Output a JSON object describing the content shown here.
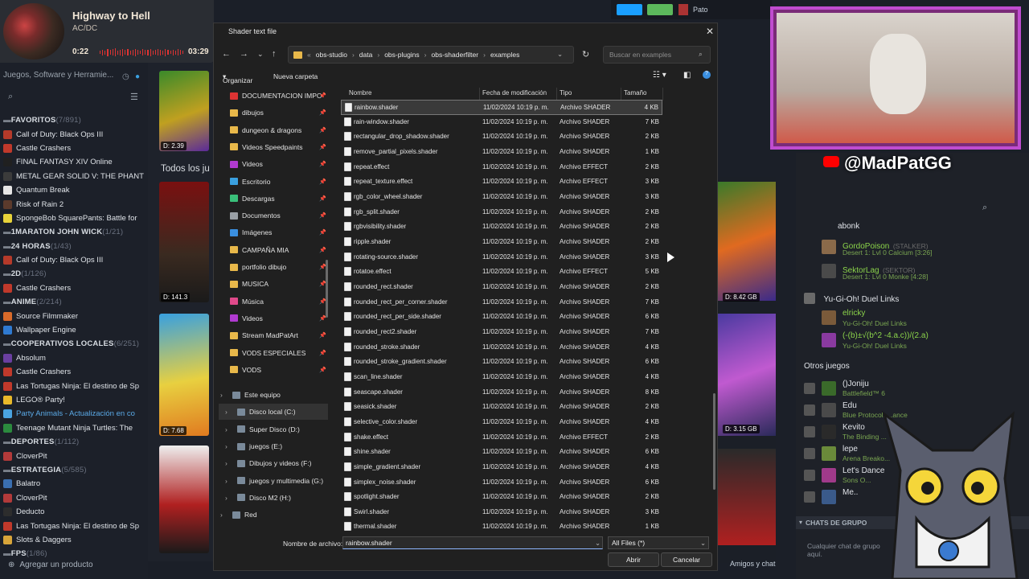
{
  "now_playing": {
    "title": "Highway to Hell",
    "artist": "AC/DC",
    "elapsed": "0:22",
    "total": "03:29",
    "progress": 0.11
  },
  "library": {
    "filter_label": "Juegos, Software y Herramie...",
    "groups": [
      {
        "type": "group",
        "name": "FAVORITOS",
        "count": "(7/891)"
      },
      {
        "type": "item",
        "name": "Call of Duty: Black Ops III",
        "color": "#b53a2a"
      },
      {
        "type": "item",
        "name": "Castle Crashers",
        "color": "#c0392b"
      },
      {
        "type": "item",
        "name": "FINAL FANTASY XIV Online",
        "color": "#202020"
      },
      {
        "type": "item",
        "name": "METAL GEAR SOLID V: THE PHANT",
        "color": "#3b3b3b"
      },
      {
        "type": "item",
        "name": "Quantum Break",
        "color": "#e6e6e6"
      },
      {
        "type": "item",
        "name": "Risk of Rain 2",
        "color": "#5b3a2c"
      },
      {
        "type": "item",
        "name": "SpongeBob SquarePants: Battle for",
        "color": "#e8d33a"
      },
      {
        "type": "group",
        "name": "1MARATON JOHN WICK",
        "count": "(1/21)"
      },
      {
        "type": "group",
        "name": "24 HORAS",
        "count": "(1/43)"
      },
      {
        "type": "item",
        "name": "Call of Duty: Black Ops III",
        "color": "#b53a2a"
      },
      {
        "type": "group",
        "name": "2D",
        "count": "(1/126)"
      },
      {
        "type": "item",
        "name": "Castle Crashers",
        "color": "#c0392b"
      },
      {
        "type": "group",
        "name": "ANIME",
        "count": "(2/214)"
      },
      {
        "type": "item",
        "name": "Source Filmmaker",
        "color": "#d86a2a"
      },
      {
        "type": "item",
        "name": "Wallpaper Engine",
        "color": "#2f7ad1"
      },
      {
        "type": "group",
        "name": "COOPERATIVOS LOCALES",
        "count": "(6/251)"
      },
      {
        "type": "item",
        "name": "Absolum",
        "color": "#6a3fa0"
      },
      {
        "type": "item",
        "name": "Castle Crashers",
        "color": "#c0392b"
      },
      {
        "type": "item",
        "name": "Las Tortugas Ninja: El destino de Sp",
        "color": "#c0392b"
      },
      {
        "type": "item",
        "name": "LEGO® Party!",
        "color": "#e8b92a"
      },
      {
        "type": "item",
        "name": "Party Animals - Actualización en co",
        "color": "#4aa3e0",
        "update": true
      },
      {
        "type": "item",
        "name": "Teenage Mutant Ninja Turtles: The",
        "color": "#2b8a3e"
      },
      {
        "type": "group",
        "name": "DEPORTES",
        "count": "(1/112)"
      },
      {
        "type": "item",
        "name": "CloverPit",
        "color": "#b23a3a"
      },
      {
        "type": "group",
        "name": "ESTRATEGIA",
        "count": "(5/585)"
      },
      {
        "type": "item",
        "name": "Balatro",
        "color": "#3a6fb0"
      },
      {
        "type": "item",
        "name": "CloverPit",
        "color": "#b23a3a"
      },
      {
        "type": "item",
        "name": "Deducto",
        "color": "#2d2d2d"
      },
      {
        "type": "item",
        "name": "Las Tortugas Ninja: El destino de Sp",
        "color": "#c0392b"
      },
      {
        "type": "item",
        "name": "Slots & Daggers",
        "color": "#d8a53a"
      },
      {
        "type": "group",
        "name": "FPS",
        "count": "(1/86)"
      }
    ],
    "add_product": "Agregar un producto",
    "all_games_label": "Todos los ju",
    "tile_sizes": [
      "D: 2.39",
      "D: 141.3",
      "D: 7.68",
      "D: 8.42 GB",
      "D: 3.15 GB"
    ]
  },
  "steam_topbar": {
    "user": "Pato"
  },
  "friends": {
    "handle": "@MadPatGG",
    "group_prefix": "abonk",
    "players": [
      {
        "name": "GordoPoison",
        "tag": "(STALKER)",
        "status": "Desert 1: Lvl 0 Calcium [3:26]"
      },
      {
        "name": "SektorLag",
        "tag": "(SEKTOR)",
        "status": "Desert 1: Lvl 0 Monke [4:28]"
      }
    ],
    "section_game": "Yu-Gi-Oh! Duel Links",
    "ygo_players": [
      {
        "name": "elricky",
        "status": "Yu-Gi-Oh! Duel Links"
      },
      {
        "name": "(-(b)±√(b^2 -4.a.c))/(2.a)",
        "status": "Yu-Gi-Oh! Duel Links"
      }
    ],
    "others_label": "Otros juegos",
    "others": [
      {
        "name": "()Joniju",
        "status": "Battlefield™ 6"
      },
      {
        "name": "Edu",
        "status": "Blue Protocol: ...ance"
      },
      {
        "name": "Kevito",
        "status": "The Binding ..."
      },
      {
        "name": "lepe",
        "status": "Arena Breako..."
      },
      {
        "name": "Let's Dance",
        "status": "Sons O..."
      },
      {
        "name": "Me..",
        "status": ""
      }
    ],
    "group_chat_label": "CHATS DE GRUPO",
    "group_chat_placeholder": "Cualquier chat de grupo aquí.",
    "friends_chat": "Amigos y chat"
  },
  "dialog": {
    "title": "Shader text file",
    "breadcrumbs": [
      "obs-studio",
      "data",
      "obs-plugins",
      "obs-shaderfilter",
      "examples"
    ],
    "search_placeholder": "Buscar en examples",
    "organize": "Organizar",
    "new_folder": "Nueva carpeta",
    "nav": [
      {
        "name": "DOCUMENTACION IMPO",
        "pinned": true,
        "color": "#d33"
      },
      {
        "name": "dibujos",
        "pinned": true,
        "color": "#e8b84a"
      },
      {
        "name": "dungeon & dragons",
        "pinned": true,
        "color": "#e8b84a"
      },
      {
        "name": "Videos Speedpaints",
        "pinned": true,
        "color": "#e8b84a"
      },
      {
        "name": "Videos",
        "pinned": true,
        "color": "#b03ad0"
      },
      {
        "name": "Escritorio",
        "pinned": true,
        "color": "#3aa0e0"
      },
      {
        "name": "Descargas",
        "pinned": true,
        "color": "#3ac07a"
      },
      {
        "name": "Documentos",
        "pinned": true,
        "color": "#9aa0a6"
      },
      {
        "name": "Imágenes",
        "pinned": true,
        "color": "#3a8fe0"
      },
      {
        "name": "CAMPAÑA MIA",
        "pinned": true,
        "color": "#e8b84a"
      },
      {
        "name": "portfolio dibujo",
        "pinned": true,
        "color": "#e8b84a"
      },
      {
        "name": "MUSICA",
        "pinned": true,
        "color": "#e8b84a"
      },
      {
        "name": "Música",
        "pinned": true,
        "color": "#e04a8a"
      },
      {
        "name": "Videos",
        "pinned": true,
        "color": "#b03ad0"
      },
      {
        "name": "Stream MadPatArt",
        "pinned": true,
        "color": "#e8b84a"
      },
      {
        "name": "VODS ESPECIALES",
        "pinned": true,
        "color": "#e8b84a"
      },
      {
        "name": "VODS",
        "pinned": true,
        "color": "#e8b84a"
      }
    ],
    "this_pc": "Este equipo",
    "drives": [
      "Disco local (C:)",
      "Super Disco (D:)",
      "juegos (E:)",
      "Dibujos y videos (F:)",
      "juegos y multimedia (G:)",
      "Disco M2 (H:)"
    ],
    "network": "Red",
    "columns": {
      "name": "Nombre",
      "date": "Fecha de modificación",
      "type": "Tipo",
      "size": "Tamaño"
    },
    "files": [
      {
        "name": "rainbow.shader",
        "date": "11/02/2024 10:19 p. m.",
        "type": "Archivo SHADER",
        "size": "4 KB"
      },
      {
        "name": "rain-window.shader",
        "date": "11/02/2024 10:19 p. m.",
        "type": "Archivo SHADER",
        "size": "7 KB"
      },
      {
        "name": "rectangular_drop_shadow.shader",
        "date": "11/02/2024 10:19 p. m.",
        "type": "Archivo SHADER",
        "size": "2 KB"
      },
      {
        "name": "remove_partial_pixels.shader",
        "date": "11/02/2024 10:19 p. m.",
        "type": "Archivo SHADER",
        "size": "1 KB"
      },
      {
        "name": "repeat.effect",
        "date": "11/02/2024 10:19 p. m.",
        "type": "Archivo EFFECT",
        "size": "2 KB"
      },
      {
        "name": "repeat_texture.effect",
        "date": "11/02/2024 10:19 p. m.",
        "type": "Archivo EFFECT",
        "size": "3 KB"
      },
      {
        "name": "rgb_color_wheel.shader",
        "date": "11/02/2024 10:19 p. m.",
        "type": "Archivo SHADER",
        "size": "3 KB"
      },
      {
        "name": "rgb_split.shader",
        "date": "11/02/2024 10:19 p. m.",
        "type": "Archivo SHADER",
        "size": "2 KB"
      },
      {
        "name": "rgbvisibility.shader",
        "date": "11/02/2024 10:19 p. m.",
        "type": "Archivo SHADER",
        "size": "2 KB"
      },
      {
        "name": "ripple.shader",
        "date": "11/02/2024 10:19 p. m.",
        "type": "Archivo SHADER",
        "size": "2 KB"
      },
      {
        "name": "rotating-source.shader",
        "date": "11/02/2024 10:19 p. m.",
        "type": "Archivo SHADER",
        "size": "3 KB"
      },
      {
        "name": "rotatoe.effect",
        "date": "11/02/2024 10:19 p. m.",
        "type": "Archivo EFFECT",
        "size": "5 KB"
      },
      {
        "name": "rounded_rect.shader",
        "date": "11/02/2024 10:19 p. m.",
        "type": "Archivo SHADER",
        "size": "2 KB"
      },
      {
        "name": "rounded_rect_per_corner.shader",
        "date": "11/02/2024 10:19 p. m.",
        "type": "Archivo SHADER",
        "size": "7 KB"
      },
      {
        "name": "rounded_rect_per_side.shader",
        "date": "11/02/2024 10:19 p. m.",
        "type": "Archivo SHADER",
        "size": "6 KB"
      },
      {
        "name": "rounded_rect2.shader",
        "date": "11/02/2024 10:19 p. m.",
        "type": "Archivo SHADER",
        "size": "7 KB"
      },
      {
        "name": "rounded_stroke.shader",
        "date": "11/02/2024 10:19 p. m.",
        "type": "Archivo SHADER",
        "size": "4 KB"
      },
      {
        "name": "rounded_stroke_gradient.shader",
        "date": "11/02/2024 10:19 p. m.",
        "type": "Archivo SHADER",
        "size": "6 KB"
      },
      {
        "name": "scan_line.shader",
        "date": "11/02/2024 10:19 p. m.",
        "type": "Archivo SHADER",
        "size": "4 KB"
      },
      {
        "name": "seascape.shader",
        "date": "11/02/2024 10:19 p. m.",
        "type": "Archivo SHADER",
        "size": "8 KB"
      },
      {
        "name": "seasick.shader",
        "date": "11/02/2024 10:19 p. m.",
        "type": "Archivo SHADER",
        "size": "2 KB"
      },
      {
        "name": "selective_color.shader",
        "date": "11/02/2024 10:19 p. m.",
        "type": "Archivo SHADER",
        "size": "4 KB"
      },
      {
        "name": "shake.effect",
        "date": "11/02/2024 10:19 p. m.",
        "type": "Archivo EFFECT",
        "size": "2 KB"
      },
      {
        "name": "shine.shader",
        "date": "11/02/2024 10:19 p. m.",
        "type": "Archivo SHADER",
        "size": "6 KB"
      },
      {
        "name": "simple_gradient.shader",
        "date": "11/02/2024 10:19 p. m.",
        "type": "Archivo SHADER",
        "size": "4 KB"
      },
      {
        "name": "simplex_noise.shader",
        "date": "11/02/2024 10:19 p. m.",
        "type": "Archivo SHADER",
        "size": "6 KB"
      },
      {
        "name": "spotlight.shader",
        "date": "11/02/2024 10:19 p. m.",
        "type": "Archivo SHADER",
        "size": "2 KB"
      },
      {
        "name": "Swirl.shader",
        "date": "11/02/2024 10:19 p. m.",
        "type": "Archivo SHADER",
        "size": "3 KB"
      },
      {
        "name": "thermal.shader",
        "date": "11/02/2024 10:19 p. m.",
        "type": "Archivo SHADER",
        "size": "1 KB"
      }
    ],
    "filename_label": "Nombre de archivo:",
    "filename_value": "rainbow.shader",
    "filetype": "All Files (*)",
    "open": "Abrir",
    "cancel": "Cancelar"
  }
}
